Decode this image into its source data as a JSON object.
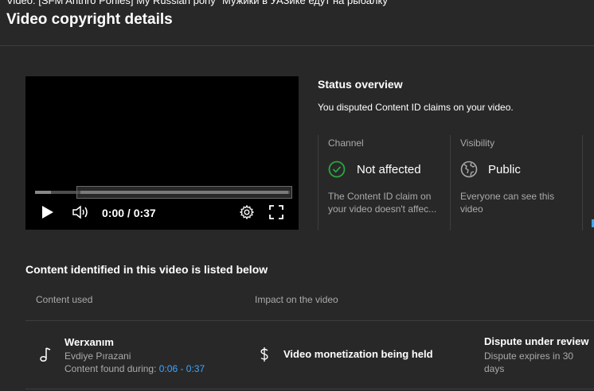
{
  "header": {
    "video_line": "Video: [SFM Anthro Ponies] My Russian pony \"Мужики в УАЗике едут на рыбалку\"",
    "title": "Video copyright details"
  },
  "player": {
    "time": "0:00 / 0:37",
    "progress_fraction": 0.0
  },
  "status": {
    "title": "Status overview",
    "description": "You disputed Content ID claims on your video.",
    "cards": [
      {
        "heading": "Channel",
        "value": "Not affected",
        "text_line1": "The Content ID claim on",
        "text_line2": "your video doesn't affec...",
        "icon": "check-circle-icon",
        "icon_color": "#2ba640"
      },
      {
        "heading": "Visibility",
        "value": "Public",
        "text_line1": "Everyone can see this",
        "text_line2": "video",
        "icon": "globe-icon"
      }
    ]
  },
  "content": {
    "section_title": "Content identified in this video is listed below",
    "col_content": "Content used",
    "col_impact": "Impact on the video",
    "rows": [
      {
        "title": "Werxanım",
        "artist": "Evdiye Pırazani",
        "found_label": "Content found during: ",
        "found_range": "0:06 - 0:37",
        "impact": "Video monetization being held",
        "dispute_status": "Dispute under review",
        "dispute_line1": "Dispute expires in 30",
        "dispute_line2": "days"
      }
    ]
  },
  "colors": {
    "background": "#282828",
    "accent_link": "#3ea6ff",
    "muted_text": "#aaaaaa"
  }
}
